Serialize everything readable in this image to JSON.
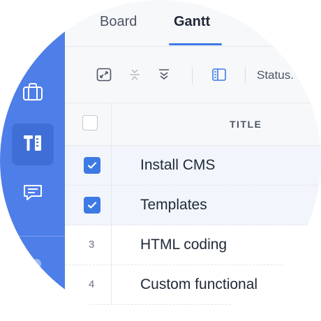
{
  "sidebar": {
    "items": [
      {
        "icon": "briefcase-icon"
      },
      {
        "icon": "tools-icon",
        "active": true
      },
      {
        "icon": "chat-icon"
      }
    ]
  },
  "tabs": [
    {
      "label": "Board"
    },
    {
      "label": "Gantt",
      "active": true
    }
  ],
  "toolbar": {
    "icons": [
      "expand-icon",
      "collapse-rows-icon",
      "collapse-down-icon",
      "panel-icon"
    ],
    "status_label": "Status."
  },
  "table": {
    "title_header": "TITLE",
    "rows": [
      {
        "marker": "checked",
        "title": "Install CMS"
      },
      {
        "marker": "checked",
        "title": "Templates"
      },
      {
        "marker": "3",
        "title": "HTML coding"
      },
      {
        "marker": "4",
        "title": "Custom functional"
      }
    ]
  },
  "colors": {
    "sidebar": "#4e7ee8",
    "accent": "#3d7ae4"
  }
}
